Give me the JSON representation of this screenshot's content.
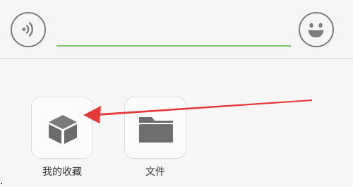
{
  "input_bar": {
    "voice_icon": "voice-icon",
    "emoji_icon": "smiley-icon",
    "text_value": "",
    "accent_color": "#7ec86e"
  },
  "tools": [
    {
      "label": "我的收藏",
      "icon": "cube-icon"
    },
    {
      "label": "文件",
      "icon": "folder-icon"
    }
  ],
  "annotation": {
    "arrow_color": "#e53a3a",
    "corner_mark": "."
  }
}
